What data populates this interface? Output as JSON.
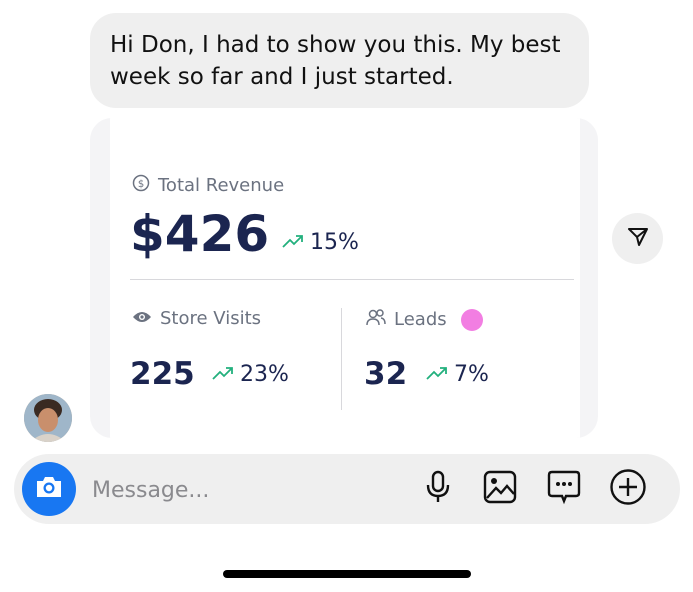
{
  "message": {
    "text": "Hi Don, I had to show you this. My best week so far and I just started."
  },
  "card": {
    "revenue": {
      "label": "Total Revenue",
      "value": "$426",
      "change": "15%"
    },
    "visits": {
      "label": "Store Visits",
      "value": "225",
      "change": "23%"
    },
    "leads": {
      "label": "Leads",
      "value": "32",
      "change": "7%"
    }
  },
  "composer": {
    "placeholder": "Message..."
  },
  "colors": {
    "accent": "#1877f2",
    "trend_up": "#22b07d",
    "value_text": "#1b2550",
    "leads_dot": "#f27ee2"
  },
  "icons": [
    "dollar-circle-icon",
    "trend-up-icon",
    "eye-icon",
    "users-icon",
    "send-icon",
    "camera-icon",
    "microphone-icon",
    "image-icon",
    "chat-dots-icon",
    "plus-circle-icon"
  ]
}
